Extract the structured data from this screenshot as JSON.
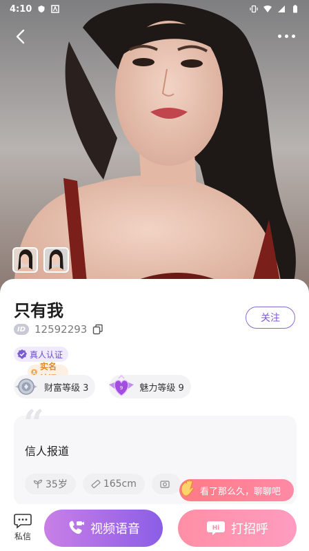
{
  "statusbar": {
    "time": "4:10",
    "left_icons": [
      "shield-icon",
      "font-a-icon"
    ],
    "right_icons": [
      "vibrate-icon",
      "wifi-icon",
      "signal-icon",
      "battery-icon"
    ]
  },
  "header": {
    "back_icon": "chevron-left-icon",
    "more_icon": "more-dots-icon"
  },
  "profile": {
    "name": "只有我",
    "id": "12592293",
    "id_badge": "ID",
    "follow_label": "关注",
    "verifications": [
      {
        "label": "真人认证",
        "icon": "real-person-verified-icon",
        "color": "#6a4cc9"
      },
      {
        "label": "实名认证",
        "icon": "real-name-verified-icon",
        "color": "#d98a2b"
      }
    ],
    "levels": [
      {
        "label": "财富等级 3",
        "icon": "wealth-level-icon"
      },
      {
        "label": "魅力等级 9",
        "icon": "charm-level-icon"
      }
    ],
    "bio": "信人报道",
    "chips": [
      {
        "label": "35岁",
        "icon": "sprout-icon"
      },
      {
        "label": "165cm",
        "icon": "ruler-icon"
      },
      {
        "label": "",
        "icon": "camera-icon"
      }
    ]
  },
  "toast": {
    "text": "看了那么久，聊聊吧"
  },
  "bottom_bar": {
    "message_label": "私信",
    "video_label": "视频语音",
    "hi_label": "打招呼"
  },
  "colors": {
    "accent_purple": "#8b5ee6",
    "accent_pink": "#ff8fa5"
  }
}
